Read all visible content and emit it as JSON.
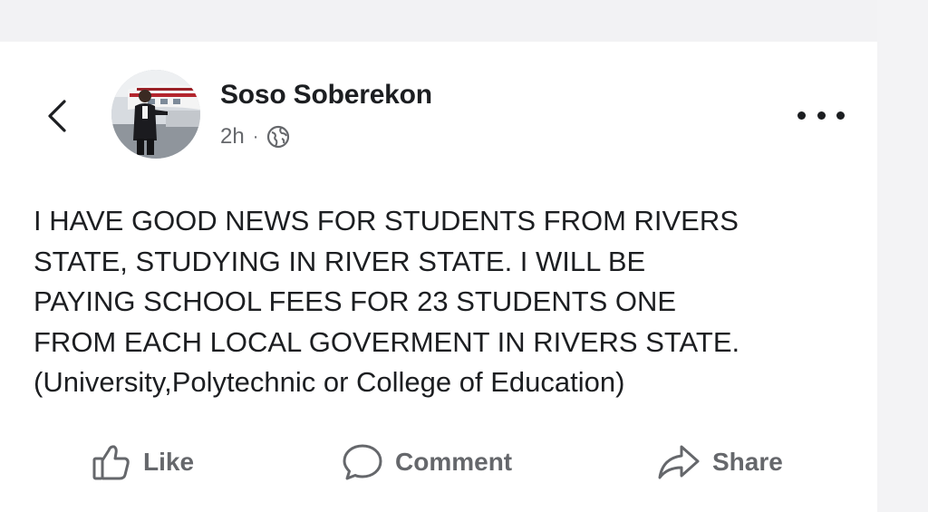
{
  "post": {
    "author": "Soso Soberekon",
    "time": "2h",
    "separator": "·",
    "text": "I HAVE GOOD NEWS FOR STUDENTS FROM RIVERS\nSTATE, STUDYING IN RIVER STATE. I WILL BE\nPAYING SCHOOL FEES FOR 23 STUDENTS ONE\nFROM EACH LOCAL GOVERMENT IN RIVERS STATE.\n(University,Polytechnic or College of Education)"
  },
  "actions": {
    "like": "Like",
    "comment": "Comment",
    "share": "Share"
  },
  "icons": {
    "back": "chevron-left-icon",
    "privacy": "globe-icon",
    "more": "more-options-icon",
    "like": "thumbs-up-icon",
    "comment": "speech-bubble-icon",
    "share": "share-arrow-icon"
  },
  "colors": {
    "text": "#1c1e21",
    "secondary": "#65676b",
    "background": "#ffffff"
  }
}
